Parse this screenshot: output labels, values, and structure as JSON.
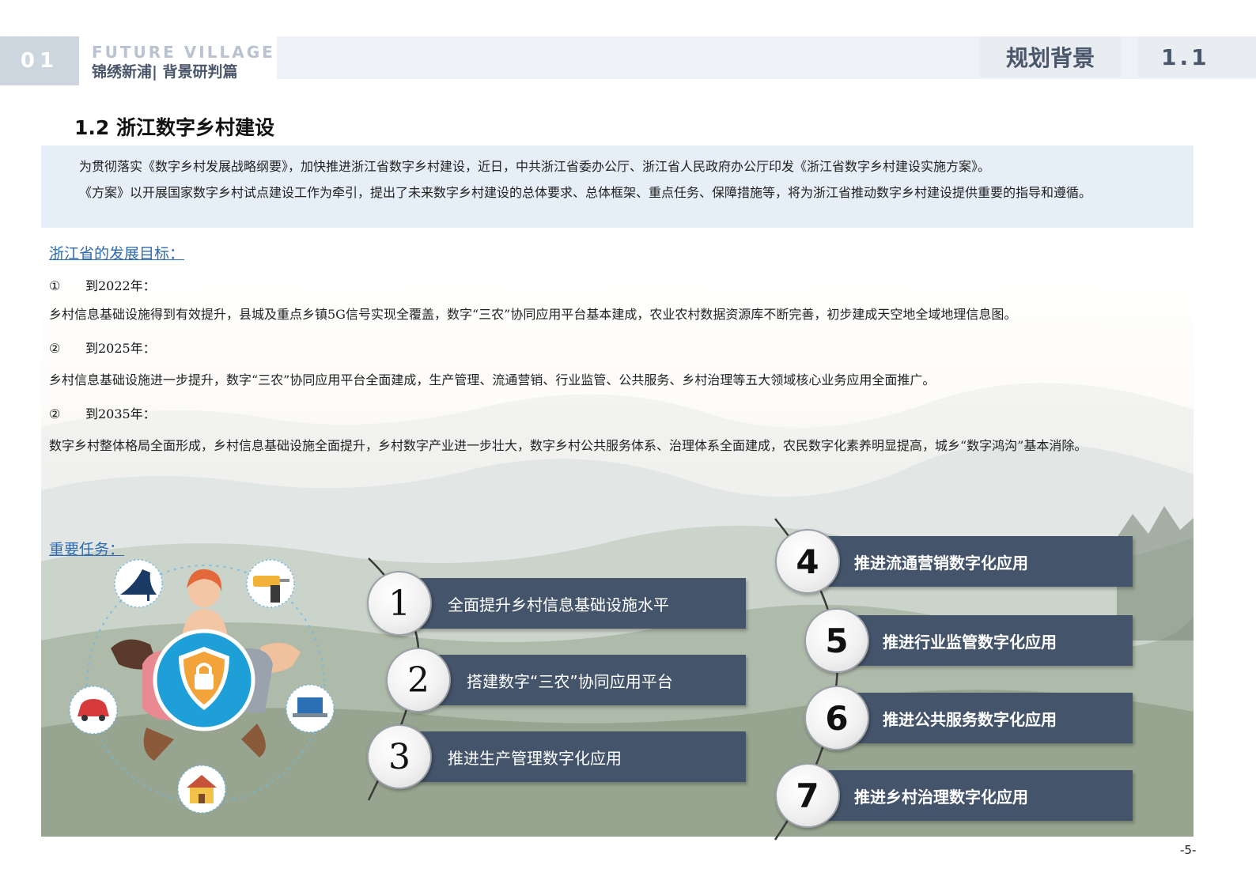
{
  "header": {
    "chapter_number": "01",
    "brand_en": "FUTURE VILLAGE",
    "brand_cn": "锦绣新浦| 背景研判篇",
    "section_title": "规划背景",
    "section_number": "1.1"
  },
  "page_title": "1.2  浙江数字乡村建设",
  "intro": {
    "paragraph_1": "为贯彻落实《数字乡村发展战略纲要》，加快推进浙江省数字乡村建设，近日，中共浙江省委办公厅、浙江省人民政府办公厅印发《浙江省数字乡村建设实施方案》。",
    "paragraph_2": "《方案》以开展国家数字乡村试点建设工作为牵引，提出了未来数字乡村建设的总体要求、总体框架、重点任务、保障措施等，将为浙江省推动数字乡村建设提供重要的指导和遵循。"
  },
  "goals": {
    "heading": "浙江省的发展目标：",
    "items": [
      {
        "marker": "①",
        "label": "到2022年：",
        "text": "乡村信息基础设施得到有效提升，县城及重点乡镇5G信号实现全覆盖，数字“三农”协同应用平台基本建成，农业农村数据资源库不断完善，初步建成天空地全域地理信息图。"
      },
      {
        "marker": "②",
        "label": "到2025年：",
        "text": "乡村信息基础设施进一步提升，数字“三农”协同应用平台全面建成，生产管理、流通营销、行业监管、公共服务、乡村治理等五大领域核心业务应用全面推广。"
      },
      {
        "marker": "②",
        "label": "到2035年：",
        "text": "数字乡村整体格局全面形成，乡村信息基础设施全面提升，乡村数字产业进一步壮大，数字乡村公共服务体系、治理体系全面建成，农民数字化素养明显提高，城乡“数字鸿沟”基本消除。"
      }
    ]
  },
  "tasks": {
    "heading": "重要任务：",
    "items": [
      {
        "number": "1",
        "label": "全面提升乡村信息基础设施水平"
      },
      {
        "number": "2",
        "label": "搭建数字“三农”协同应用平台"
      },
      {
        "number": "3",
        "label": "推进生产管理数字化应用"
      },
      {
        "number": "4",
        "label": "推进流通营销数字化应用"
      },
      {
        "number": "5",
        "label": "推进行业监管数字化应用"
      },
      {
        "number": "6",
        "label": "推进公共服务数字化应用"
      },
      {
        "number": "7",
        "label": "推进乡村治理数字化应用"
      }
    ]
  },
  "page_number": "-5-",
  "colors": {
    "task_bar": "#44546a",
    "link_blue": "#2e6bb0",
    "intro_bg": "#e6eef7",
    "shield_blue": "#1e9fd8",
    "lock_orange": "#f2a33a"
  },
  "illustration_icons": [
    "high-heel-icon",
    "drill-icon",
    "person-icon",
    "shield-lock-icon",
    "car-icon",
    "laptop-icon",
    "house-icon",
    "hand-icon"
  ]
}
